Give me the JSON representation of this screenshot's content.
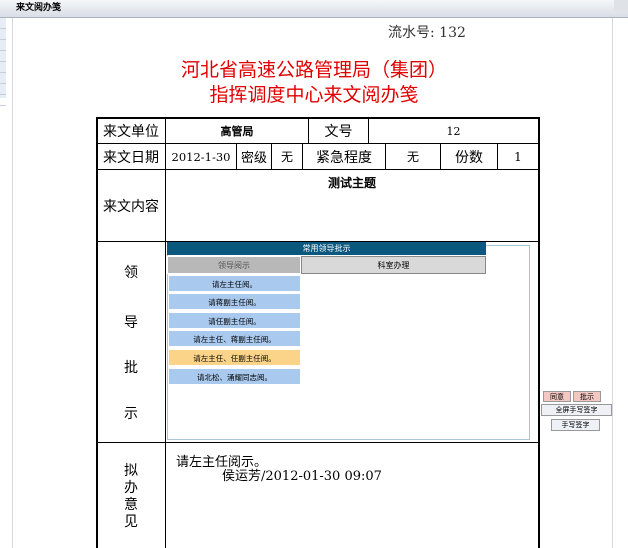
{
  "window": {
    "title": "来文阅办笺"
  },
  "header": {
    "serial": "流水号: 132",
    "title_line1": "河北省高速公路管理局（集团）",
    "title_line2": "指挥调度中心来文阅办笺"
  },
  "form": {
    "unit_label": "来文单位",
    "unit_value": "高管局",
    "docno_label": "文号",
    "docno_value": "12",
    "date_label": "来文日期",
    "date_value": "2012-1-30",
    "secret_label": "密级",
    "secret_value": "无",
    "urgency_label": "紧急程度",
    "urgency_value": "无",
    "copies_label": "份数",
    "copies_value": "1",
    "content_label": "来文内容",
    "content_value": "测试主题",
    "leader_label_1": "领",
    "leader_label_2": "导",
    "leader_label_3": "批",
    "leader_label_4": "示",
    "opinion_label_1": "拟",
    "opinion_label_2": "办",
    "opinion_label_3": "意",
    "opinion_label_4": "见",
    "opinion_text": "请左主任阅示。",
    "opinion_sign": "侯运芳/2012-01-30 09:07"
  },
  "popup": {
    "title": "常用领导批示",
    "tabs": [
      "领导阅示",
      "科室办理"
    ],
    "items": [
      "请左主任阅。",
      "请蒋副主任阅。",
      "请任副主任阅。",
      "请左主任、蒋副主任阅。",
      "请左主任、任副主任阅。",
      "请北松、涌耀同志阅。"
    ]
  },
  "side_buttons": {
    "agree": "同意",
    "approve": "批示",
    "fullscreen_sign": "全屏手写签字",
    "hand_sign": "手写签字"
  }
}
